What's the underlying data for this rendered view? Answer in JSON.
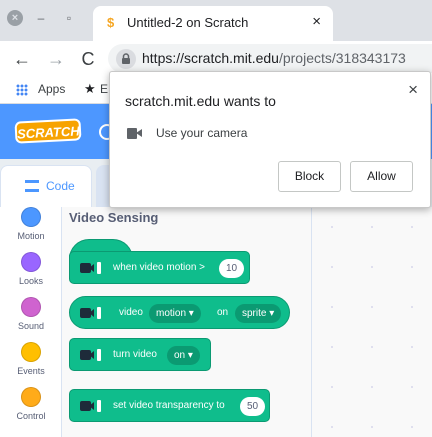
{
  "browser": {
    "tab_title": "Untitled-2 on Scratch",
    "tab_close": "×",
    "url_host": "https://scratch.mit.edu",
    "url_path": "/projects/318343173",
    "window_close": "×",
    "window_min": "–",
    "window_max": "▫"
  },
  "bookmarks": {
    "apps_label": "Apps",
    "star": "★",
    "partial": "E"
  },
  "nav": {
    "back": "←",
    "forward": "→",
    "reload": "C"
  },
  "scratch": {
    "logo_text": "SCRATCH",
    "code_tab_label": "Code"
  },
  "categories": [
    {
      "name": "Motion",
      "color": "#4c97ff"
    },
    {
      "name": "Looks",
      "color": "#9966ff"
    },
    {
      "name": "Sound",
      "color": "#cf63cf"
    },
    {
      "name": "Events",
      "color": "#ffbf00"
    },
    {
      "name": "Control",
      "color": "#ffab19"
    }
  ],
  "palette": {
    "title": "Video Sensing",
    "blocks": {
      "when_motion_text": "when video motion >",
      "when_motion_value": "10",
      "video_text": "video",
      "video_attr": "motion ▾",
      "on_text": "on",
      "video_target": "sprite ▾",
      "turn_text": "turn video",
      "turn_value": "on ▾",
      "transparency_text": "set video transparency to",
      "transparency_value": "50"
    }
  },
  "popup": {
    "title": "scratch.mit.edu wants to",
    "close": "×",
    "permission": "Use your camera",
    "block_label": "Block",
    "allow_label": "Allow"
  },
  "colors": {
    "scratch_blue": "#4d97ff",
    "video_sensing_green": "#0fbd8c"
  }
}
